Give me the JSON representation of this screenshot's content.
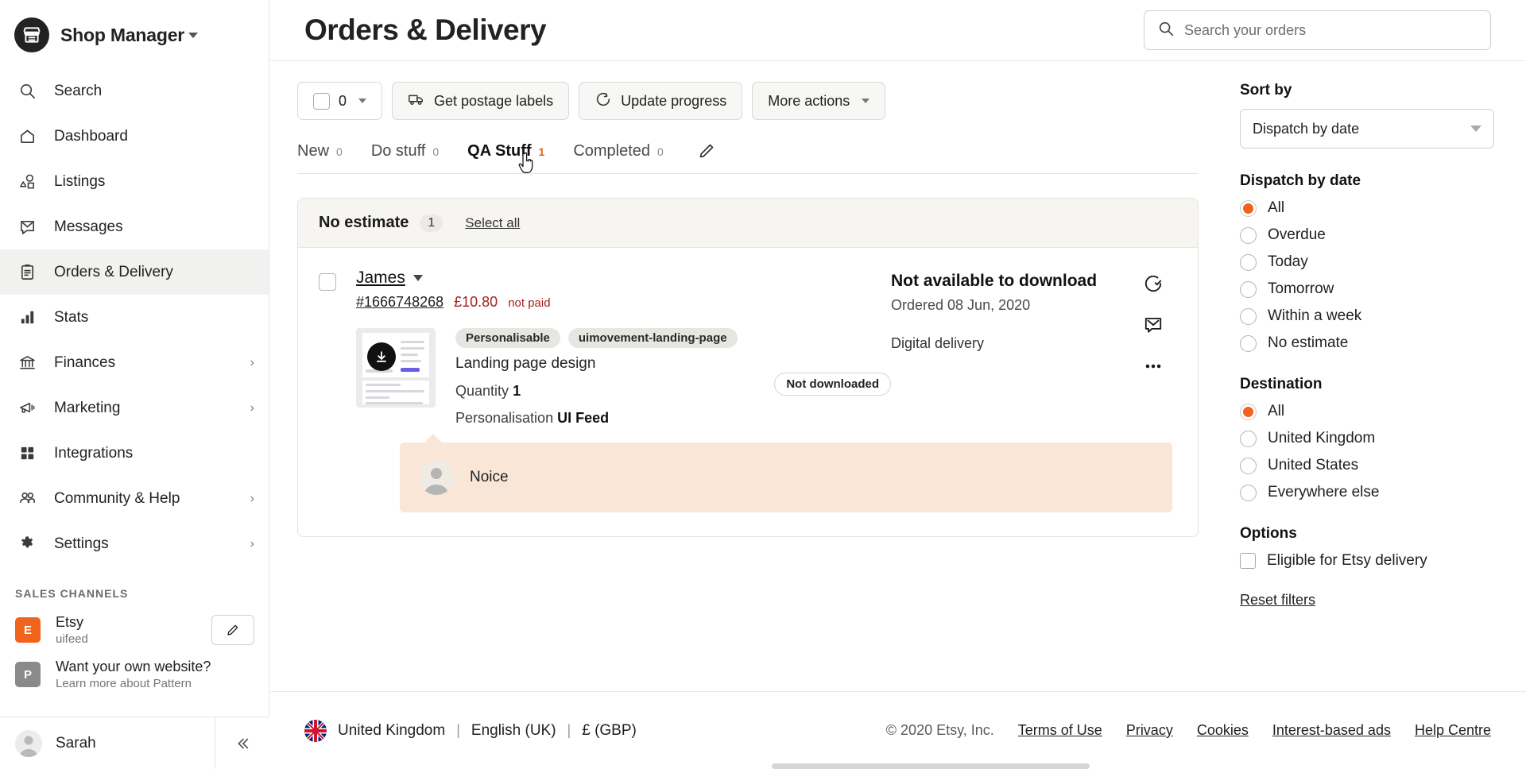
{
  "sidebar": {
    "shop_title": "Shop Manager",
    "logo_icon": "shop-storefront-icon",
    "items": [
      {
        "label": "Search",
        "icon": "search-icon",
        "expandable": false,
        "active": false
      },
      {
        "label": "Dashboard",
        "icon": "home-icon",
        "expandable": false,
        "active": false
      },
      {
        "label": "Listings",
        "icon": "shapes-icon",
        "expandable": false,
        "active": false
      },
      {
        "label": "Messages",
        "icon": "envelope-chat-icon",
        "expandable": false,
        "active": false
      },
      {
        "label": "Orders & Delivery",
        "icon": "clipboard-icon",
        "expandable": false,
        "active": true
      },
      {
        "label": "Stats",
        "icon": "bar-chart-icon",
        "expandable": false,
        "active": false
      },
      {
        "label": "Finances",
        "icon": "bank-icon",
        "expandable": true,
        "active": false
      },
      {
        "label": "Marketing",
        "icon": "megaphone-icon",
        "expandable": true,
        "active": false
      },
      {
        "label": "Integrations",
        "icon": "grid-squares-icon",
        "expandable": false,
        "active": false
      },
      {
        "label": "Community & Help",
        "icon": "people-icon",
        "expandable": true,
        "active": false
      },
      {
        "label": "Settings",
        "icon": "gear-icon",
        "expandable": true,
        "active": false
      }
    ],
    "sales_channels_title": "SALES CHANNELS",
    "channels": [
      {
        "badge": "E",
        "badge_color": "#f1641e",
        "name": "Etsy",
        "sub": "uifeed",
        "has_edit": true
      },
      {
        "badge": "P",
        "badge_color": "#8a8a8a",
        "name": "Want your own website?",
        "sub": "Learn more about Pattern",
        "has_edit": false
      }
    ],
    "user": {
      "name": "Sarah",
      "avatar_icon": "user-avatar-icon"
    },
    "collapse_icon": "chevron-double-left-icon"
  },
  "header": {
    "title": "Orders & Delivery",
    "search": {
      "placeholder": "Search your orders",
      "value": "",
      "icon": "search-icon"
    }
  },
  "toolbar": {
    "selection_count": "0",
    "selection_checkbox_checked": false,
    "buttons": [
      {
        "label": "Get postage labels",
        "icon": "delivery-van-icon"
      },
      {
        "label": "Update progress",
        "icon": "progress-check-icon"
      },
      {
        "label": "More actions",
        "icon": "",
        "has_caret": true
      }
    ]
  },
  "tabs": {
    "items": [
      {
        "label": "New",
        "count": "0",
        "active": false
      },
      {
        "label": "Do stuff",
        "count": "0",
        "active": false
      },
      {
        "label": "QA Stuff",
        "count": "1",
        "active": true
      },
      {
        "label": "Completed",
        "count": "0",
        "active": false
      }
    ],
    "edit_icon": "pencil-icon"
  },
  "order_group": {
    "title": "No estimate",
    "count": "1",
    "select_all": "Select all"
  },
  "order": {
    "buyer": "James",
    "order_id": "#1666748268",
    "price": "£10.80",
    "payment_status": "not paid",
    "tags": [
      "Personalisable",
      "uimovement-landing-page"
    ],
    "item_title": "Landing page design",
    "quantity_label": "Quantity",
    "quantity_value": "1",
    "personalisation_label": "Personalisation",
    "personalisation_value": "UI Feed",
    "download_badge": "Not downloaded",
    "download_status": "Not available to download",
    "ordered_on": "Ordered 08 Jun, 2020",
    "delivery_type": "Digital delivery",
    "actions": [
      {
        "icon": "progress-check-icon",
        "name": "mark-progress"
      },
      {
        "icon": "envelope-icon",
        "name": "message-buyer"
      },
      {
        "icon": "ellipsis-icon",
        "name": "more-options"
      }
    ],
    "note": {
      "text": "Noice",
      "avatar_icon": "user-avatar-icon"
    },
    "thumbnail_icon": "download-circle-icon"
  },
  "filters": {
    "sort_by_label": "Sort by",
    "sort_by_value": "Dispatch by date",
    "dispatch_label": "Dispatch by date",
    "dispatch_options": [
      {
        "label": "All",
        "selected": true
      },
      {
        "label": "Overdue",
        "selected": false
      },
      {
        "label": "Today",
        "selected": false
      },
      {
        "label": "Tomorrow",
        "selected": false
      },
      {
        "label": "Within a week",
        "selected": false
      },
      {
        "label": "No estimate",
        "selected": false
      }
    ],
    "destination_label": "Destination",
    "destination_options": [
      {
        "label": "All",
        "selected": true
      },
      {
        "label": "United Kingdom",
        "selected": false
      },
      {
        "label": "United States",
        "selected": false
      },
      {
        "label": "Everywhere else",
        "selected": false
      }
    ],
    "options_label": "Options",
    "checkbox_options": [
      {
        "label": "Eligible for Etsy delivery",
        "checked": false
      }
    ],
    "reset_label": "Reset filters"
  },
  "footer": {
    "country": "United Kingdom",
    "language": "English (UK)",
    "currency": "£ (GBP)",
    "separator": "|",
    "copyright": "© 2020 Etsy, Inc.",
    "links": [
      "Terms of Use",
      "Privacy",
      "Cookies",
      "Interest-based ads",
      "Help Centre"
    ]
  },
  "colors": {
    "accent": "#f1641e",
    "danger": "#a61f1f",
    "note_bg": "#fae6d7"
  }
}
